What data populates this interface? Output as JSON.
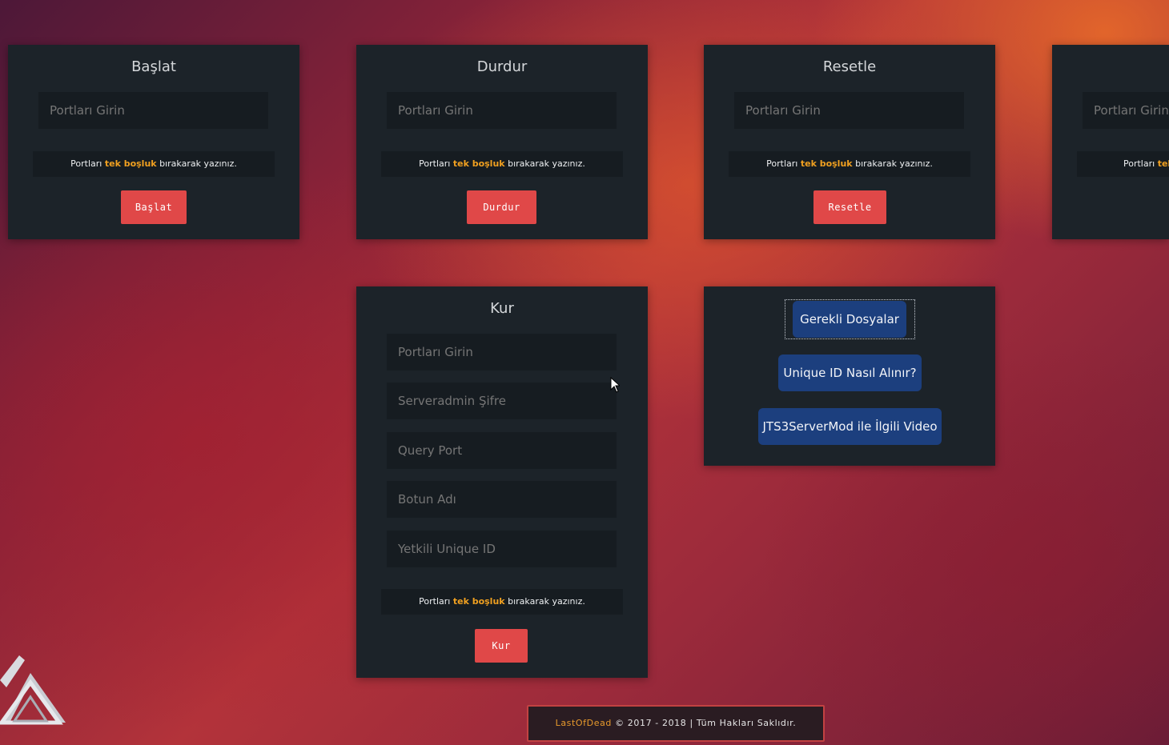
{
  "note": {
    "prefix": "Portları ",
    "highlight": "tek boşluk",
    "suffix": " bırakarak yazınız."
  },
  "cards": {
    "baslat": {
      "title": "Başlat",
      "placeholder": "Portları Girin",
      "button": "Başlat"
    },
    "durdur": {
      "title": "Durdur",
      "placeholder": "Portları Girin",
      "button": "Durdur"
    },
    "resetle": {
      "title": "Resetle",
      "placeholder": "Portları Girin",
      "button": "Resetle"
    },
    "fourth": {
      "placeholder": "Portları Girin",
      "note_prefix": "Portları ",
      "note_highlight": "tek"
    },
    "kur": {
      "title": "Kur",
      "fields": [
        "Portları Girin",
        "Serveradmin Şifre",
        "Query Port",
        "Botun Adı",
        "Yetkili Unique ID"
      ],
      "button": "Kur"
    }
  },
  "links": {
    "files": "Gerekli Dosyalar",
    "unique_id": "Unique ID Nasıl Alınır?",
    "video": "JTS3ServerMod ile İlgili Video"
  },
  "footer": {
    "brand": "LastOfDead",
    "text": " © 2017 - 2018 | Tüm Hakları Saklıdır."
  },
  "colors": {
    "accent_red": "#e04848",
    "highlight_orange": "#f0a020",
    "link_blue": "#1c3f7e",
    "card_bg": "#1c2329"
  }
}
